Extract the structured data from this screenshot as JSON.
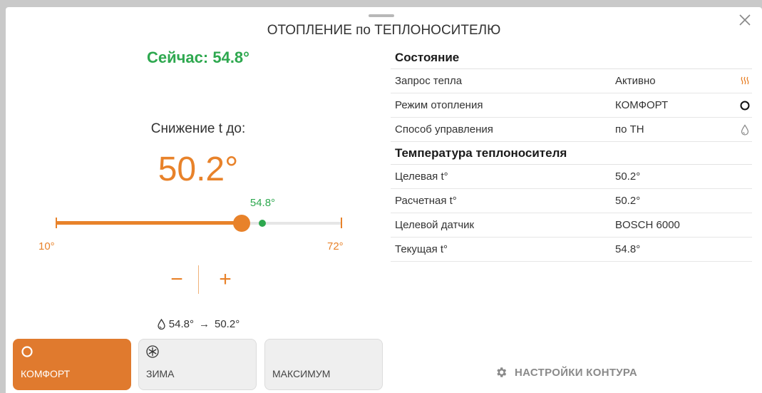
{
  "dialog": {
    "title": "ОТОПЛЕНИЕ по ТЕПЛОНОСИТЕЛЮ"
  },
  "control": {
    "current": "Сейчас: 54.8°",
    "reduce_label": "Снижение t до:",
    "target": "50.2°",
    "slider": {
      "min": 10,
      "max": 72,
      "value": 50.2,
      "current": 54.8,
      "min_label": "10°",
      "max_label": "72°",
      "current_label": "54.8°"
    },
    "stepper": {
      "minus": "−",
      "plus": "+"
    },
    "summary": {
      "from": "54.8°",
      "arrow": "→",
      "to": "50.2°"
    }
  },
  "modes": [
    {
      "label": "КОМФОРТ",
      "icon": "circle-icon",
      "active": true
    },
    {
      "label": "ЗИМА",
      "icon": "snowflake-icon",
      "active": false
    },
    {
      "label": "МАКСИМУМ",
      "icon": "",
      "active": false
    }
  ],
  "settings_button": {
    "label": "НАСТРОЙКИ КОНТУРА",
    "icon": "gear-icon"
  },
  "status": {
    "title": "Состояние",
    "rows": [
      {
        "label": "Запрос тепла",
        "value": "Активно",
        "icon": "heat-waves-icon"
      },
      {
        "label": "Режим отопления",
        "value": "КОМФОРТ",
        "icon": "circle-icon"
      },
      {
        "label": "Способ управления",
        "value": "по ТН",
        "icon": "drop-icon"
      }
    ]
  },
  "coolant": {
    "title": "Температура теплоносителя",
    "rows": [
      {
        "label": "Целевая t°",
        "value": "50.2°"
      },
      {
        "label": "Расчетная t°",
        "value": "50.2°"
      },
      {
        "label": "Целевой датчик",
        "value": "BOSCH 6000"
      },
      {
        "label": "Текущая t°",
        "value": "54.8°"
      }
    ]
  },
  "colors": {
    "accent": "#e8822a",
    "active_button": "#e07a2e",
    "current": "#2ea84f"
  }
}
